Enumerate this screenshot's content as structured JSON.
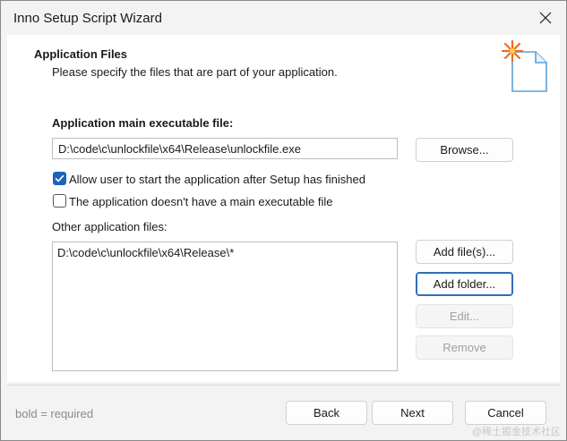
{
  "window": {
    "title": "Inno Setup Script Wizard",
    "close_label": "✕"
  },
  "header": {
    "title": "Application Files",
    "subtitle": "Please specify the files that are part of your application.",
    "icon": "wizard-file-icon",
    "icon_accent_color": "#f26b1d"
  },
  "main_exe": {
    "label": "Application main executable file:",
    "value": "D:\\code\\c\\unlockfile\\x64\\Release\\unlockfile.exe",
    "browse_label": "Browse..."
  },
  "options": {
    "allow_start": {
      "label": "Allow user to start the application after Setup has finished",
      "checked": true
    },
    "no_main_exe": {
      "label": "The application doesn't have a main executable file",
      "checked": false
    }
  },
  "other_files": {
    "label": "Other application files:",
    "items": [
      "D:\\code\\c\\unlockfile\\x64\\Release\\*"
    ],
    "add_files_label": "Add file(s)...",
    "add_folder_label": "Add folder...",
    "edit_label": "Edit...",
    "remove_label": "Remove"
  },
  "footer": {
    "required_hint": "bold = required",
    "back_label": "Back",
    "next_label": "Next",
    "cancel_label": "Cancel"
  },
  "watermark": "@稀土掘金技术社区",
  "colors": {
    "accent": "#1d63b8",
    "focus_border": "#2e6fb8"
  }
}
